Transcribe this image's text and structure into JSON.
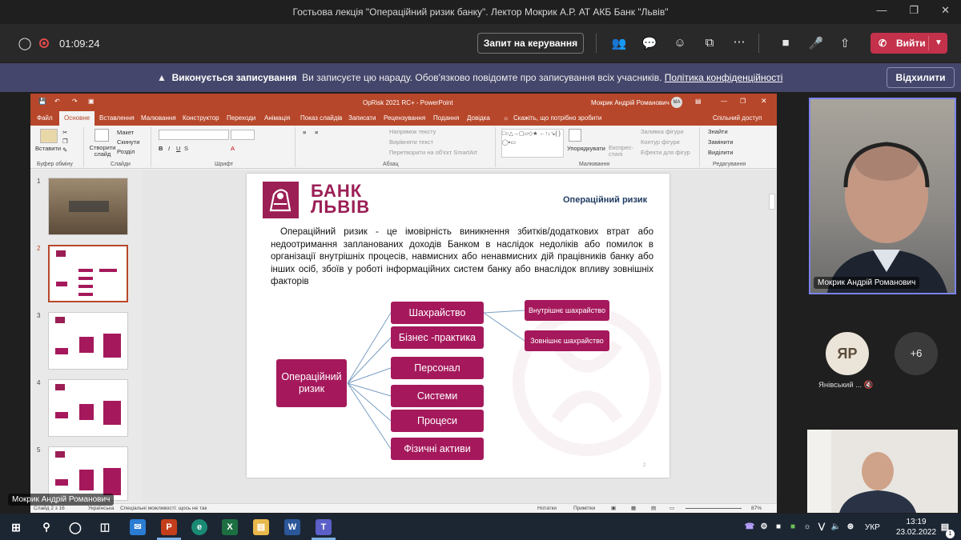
{
  "window": {
    "title": "Гостьова лекція \"Операційний ризик банку\". Лектор Мокрик А.Р. АТ АКБ Банк \"Львів\""
  },
  "call": {
    "timer": "01:09:24",
    "request_control_label": "Запит на керування",
    "leave_label": "Вийти"
  },
  "banner": {
    "bold": "Виконується записування",
    "text": "Ви записуєте цю нараду. Обов'язково повідомте про записування всіх учасників.",
    "link": "Політика конфіденційності",
    "dismiss_label": "Відхилити"
  },
  "ppt": {
    "file_title": "OpRisk 2021 RC+  -  PowerPoint",
    "user": "Мокрик Андрій Романович",
    "user_initials": "MA",
    "tabs": [
      "Файл",
      "Основне",
      "Вставлення",
      "Малювання",
      "Конструктор",
      "Переходи",
      "Анімація",
      "Показ слайдів",
      "Записати",
      "Рецензування",
      "Подання",
      "Довідка"
    ],
    "tell_me": "Скажіть, що потрібно зробити",
    "share": "Спільний доступ",
    "ribbon": {
      "paste": "Вставити",
      "clipboard_group": "Буфер обміну",
      "new_slide": "Створити слайд",
      "layout": "Макет",
      "reset": "Скинути",
      "section": "Розділ",
      "slides_group": "Слайди",
      "font_group": "Шрифт",
      "text_direction": "Напрямок тексту",
      "align_text": "Вирівняти текст",
      "convert_smartart": "Перетворити на об'єкт SmartArt",
      "paragraph_group": "Абзац",
      "arrange": "Упорядкувати",
      "quick_styles": "Експрес-стилі",
      "shape_fill": "Заливка фігури",
      "shape_outline": "Контур фігури",
      "shape_effects": "Ефекти для фігур",
      "drawing_group": "Малювання",
      "find": "Знайти",
      "replace": "Замінити",
      "select": "Виділити",
      "editing_group": "Редагування"
    },
    "thumbnails": [
      "1",
      "2",
      "3",
      "4",
      "5"
    ],
    "status": {
      "slide_of": "Слайд 2 з 16",
      "language": "Українська",
      "accessibility": "Спеціальні можливості: щось не так",
      "notes": "Нотатки",
      "comments": "Примітки",
      "zoom": "87%"
    }
  },
  "slide": {
    "logo_line1": "БАНК",
    "logo_line2": "ЛЬВІВ",
    "title": "Операційний ризик",
    "body": "Операційний ризик - це імовірність виникнення збитків/додаткових втрат або недоотримання запланованих доходів Банком в наслідок недоліків або помилок в організації внутрішніх процесів, навмисних або ненавмисних дій працівників банку або інших осіб, збоїв у роботі інформаційних систем банку або внаслідок впливу зовнішніх факторів",
    "root_node": "Операційний ризик",
    "branches": [
      "Шахрайство",
      "Бізнес -практика",
      "Персонал",
      "Системи",
      "Процеси",
      "Фізичні активи"
    ],
    "fraud_sub": [
      "Внутрішнє шахрайство",
      "Зовнішнє шахрайство"
    ],
    "page_number": "2"
  },
  "participants": {
    "presenter": "Мокрик Андрій Романович",
    "avatar_initials": "ЯР",
    "avatar_name": "Янівський ...",
    "more_count": "+6",
    "lower_label": "Мокрик Андрій Романович"
  },
  "taskbar": {
    "language": "УКР",
    "time": "13:19",
    "date": "23.02.2022",
    "notifications": "1"
  }
}
